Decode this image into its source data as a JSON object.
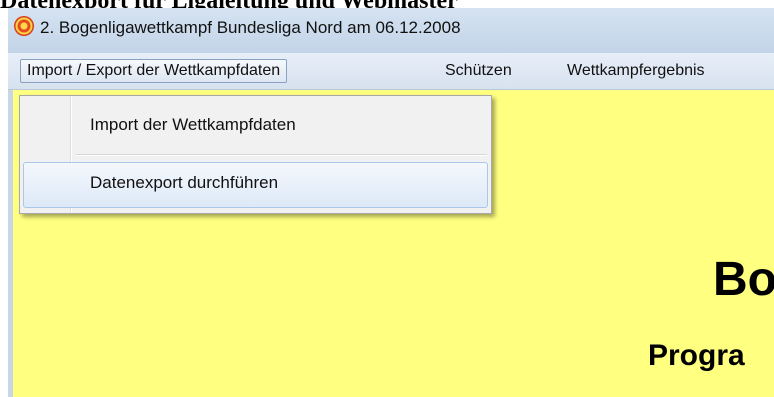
{
  "page_heading": "Datenexport für Ligaleitung und Webmaster",
  "window": {
    "title": "2. Bogenligawettkampf Bundesliga Nord am 06.12.2008",
    "icon": "target-icon"
  },
  "menubar": {
    "items": [
      "Import / Export der Wettkampfdaten",
      "Schützen",
      "Wettkampfergebnis"
    ]
  },
  "dropdown": {
    "items": [
      "Import der Wettkampfdaten",
      "Datenexport durchführen"
    ],
    "hovered_index": 1
  },
  "content": {
    "heading": "Bo",
    "subheading": "Progra",
    "background_color": "#ffff80"
  }
}
